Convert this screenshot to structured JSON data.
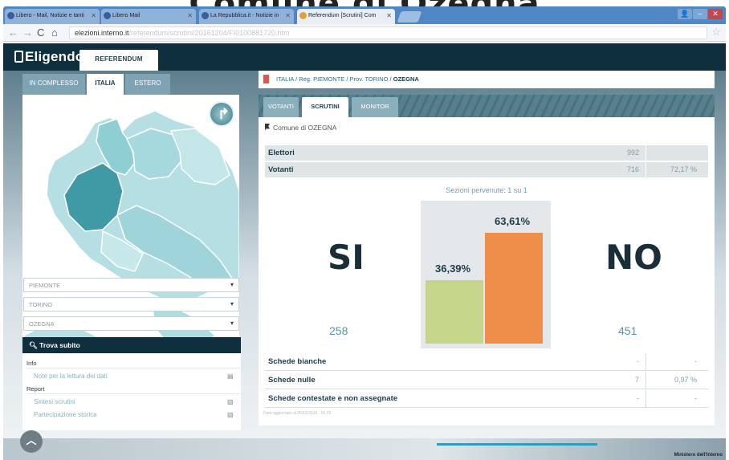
{
  "page_title": "Comune di Ozegna",
  "browser": {
    "tabs": [
      {
        "label": "Libero - Mail, Notizie e tanti"
      },
      {
        "label": "Libero Mail"
      },
      {
        "label": "La Repubblica.it - Notizie in"
      },
      {
        "label": "Referendum [Scrutini] Com"
      }
    ],
    "url_host": "elezioni.interno.it",
    "url_path": "/referendum/scrutini/20161204/FI0100881720.htm"
  },
  "app": {
    "logo": "Eligendo",
    "top_tab": "REFERENDUM"
  },
  "left": {
    "tabs": [
      "IN COMPLESSO",
      "ITALIA",
      "ESTERO"
    ],
    "selects": [
      "PIEMONTE",
      "TORINO",
      "OZEGNA"
    ],
    "trova": "Trova subito",
    "info_title": "Info",
    "info_link": "Note per la lettura dei dati",
    "report_title": "Report",
    "report_links": [
      "Sintesi scrutini",
      "Partecipazione storica"
    ]
  },
  "breadcrumb": {
    "prefix": "ITALIA / Reg. PIEMONTE / Prov. TORINO / ",
    "current": "OZEGNA"
  },
  "subtabs": [
    "VOTANTI",
    "SCRUTINI",
    "MONITOR"
  ],
  "comune": "Comune di OZEGNA",
  "elettori": {
    "label": "Elettori",
    "value": "992"
  },
  "votanti": {
    "label": "Votanti",
    "value": "716",
    "pct": "72,17 %"
  },
  "sezioni": "Sezioni pervenute: 1 su 1",
  "si": {
    "label": "SI",
    "votes": "258",
    "pct": "36,39%"
  },
  "no": {
    "label": "NO",
    "votes": "451",
    "pct": "63,61%"
  },
  "chart_data": {
    "type": "bar",
    "categories": [
      "SI",
      "NO"
    ],
    "values": [
      36.39,
      63.61
    ],
    "colors": [
      "#c5d68a",
      "#ef8d4b"
    ]
  },
  "schede": [
    {
      "label": "Schede bianche",
      "value": "-",
      "pct": "-"
    },
    {
      "label": "Schede nulle",
      "value": "7",
      "pct": "0,97 %"
    },
    {
      "label": "Schede contestate e non assegnate",
      "value": "-",
      "pct": "-"
    }
  ],
  "updated": "Dato aggiornato al 05/12/2016 - 01:25",
  "footer": "Ministero dell'Interno"
}
